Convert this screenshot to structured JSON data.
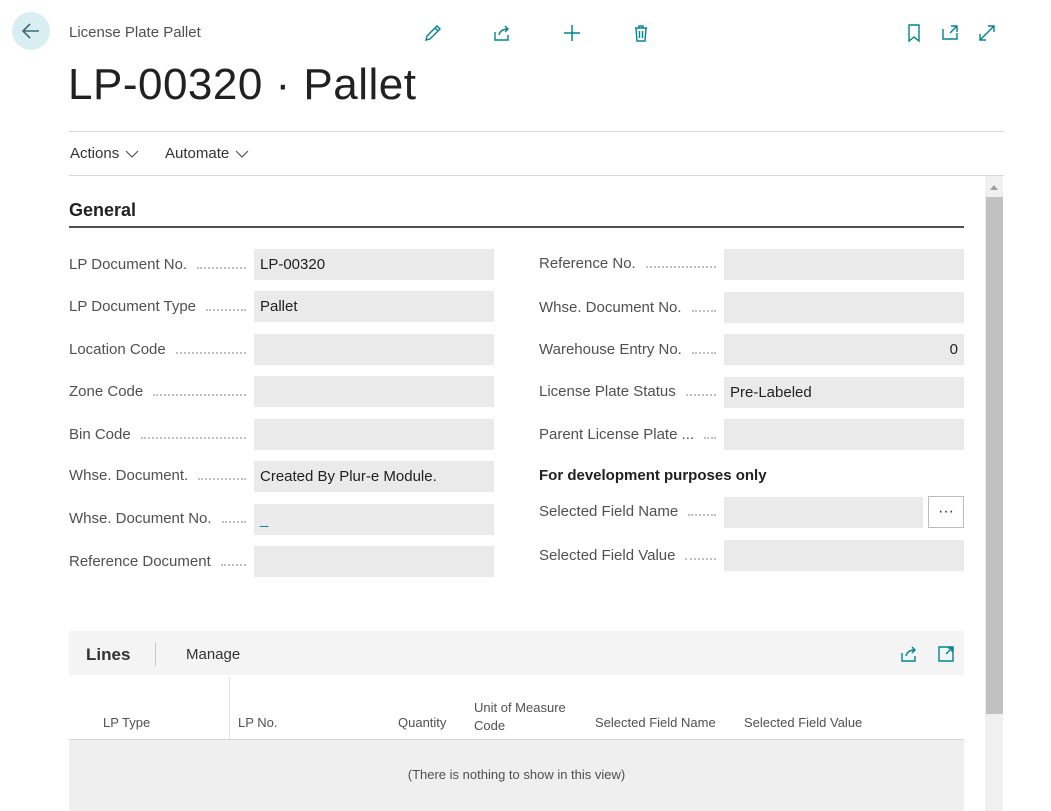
{
  "header": {
    "breadcrumb": "License Plate Pallet",
    "title": "LP-00320 · Pallet"
  },
  "menu": {
    "actions_label": "Actions",
    "automate_label": "Automate"
  },
  "general": {
    "section_title": "General",
    "left_fields": [
      {
        "label": "LP Document No.",
        "value": "LP-00320"
      },
      {
        "label": "LP Document Type",
        "value": "Pallet"
      },
      {
        "label": "Location Code",
        "value": ""
      },
      {
        "label": "Zone Code",
        "value": ""
      },
      {
        "label": "Bin Code",
        "value": ""
      },
      {
        "label": "Whse. Document.",
        "value": "Created By Plur-e Module."
      },
      {
        "label": "Whse. Document No.",
        "value": "_"
      },
      {
        "label": "Reference Document",
        "value": ""
      }
    ],
    "right_fields": [
      {
        "label": "Reference No.",
        "value": ""
      },
      {
        "label": "Whse. Document No.",
        "value": ""
      },
      {
        "label": "Warehouse Entry No.",
        "value": "0"
      },
      {
        "label": "License Plate Status",
        "value": "Pre-Labeled"
      },
      {
        "label": "Parent License Plate ...",
        "value": ""
      }
    ],
    "dev_title": "For development purposes only",
    "dev_fields": [
      {
        "label": "Selected Field Name",
        "value": ""
      },
      {
        "label": "Selected Field Value",
        "value": ""
      }
    ],
    "ellipsis": "···"
  },
  "lines": {
    "title": "Lines",
    "manage_label": "Manage",
    "columns": {
      "lp_type": "LP Type",
      "lp_no": "LP No.",
      "quantity": "Quantity",
      "uom_line1": "Unit of Measure",
      "uom_line2": "Code",
      "sel_name": "Selected Field Name",
      "sel_value": "Selected Field Value"
    },
    "empty_text": "(There is nothing to show in this view)"
  },
  "colors": {
    "accent": "#00858f",
    "back_button_bg": "#d9eef0",
    "input_bg": "#eaeaea"
  }
}
